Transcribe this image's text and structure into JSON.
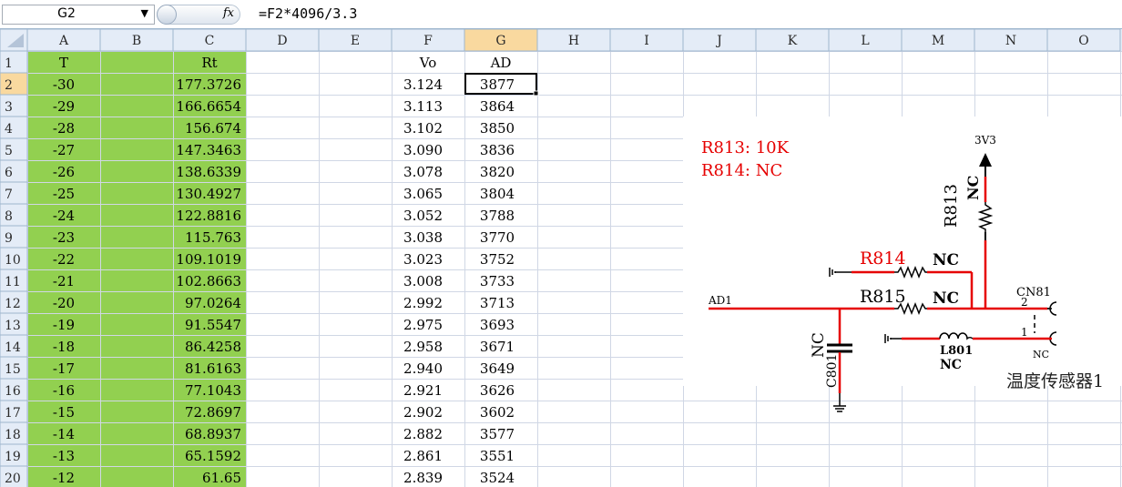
{
  "name_box": {
    "value": "G2",
    "dropdown_glyph": "▼"
  },
  "formula_bar": {
    "fx_label": "fx",
    "formula": "=F2*4096/3.3"
  },
  "sheet": {
    "columns": [
      "A",
      "B",
      "C",
      "D",
      "E",
      "F",
      "G",
      "H",
      "I",
      "J",
      "K",
      "L",
      "M",
      "N",
      "O"
    ],
    "selected_column": "G",
    "selected_row": 2,
    "header_row": {
      "A": "T",
      "C": "Rt",
      "F": "Vo",
      "G": "AD"
    },
    "rows": [
      {
        "n": 2,
        "T": "-30",
        "Rt": "177.3726",
        "Vo": "3.124",
        "AD": "3877"
      },
      {
        "n": 3,
        "T": "-29",
        "Rt": "166.6654",
        "Vo": "3.113",
        "AD": "3864"
      },
      {
        "n": 4,
        "T": "-28",
        "Rt": "156.674",
        "Vo": "3.102",
        "AD": "3850"
      },
      {
        "n": 5,
        "T": "-27",
        "Rt": "147.3463",
        "Vo": "3.090",
        "AD": "3836"
      },
      {
        "n": 6,
        "T": "-26",
        "Rt": "138.6339",
        "Vo": "3.078",
        "AD": "3820"
      },
      {
        "n": 7,
        "T": "-25",
        "Rt": "130.4927",
        "Vo": "3.065",
        "AD": "3804"
      },
      {
        "n": 8,
        "T": "-24",
        "Rt": "122.8816",
        "Vo": "3.052",
        "AD": "3788"
      },
      {
        "n": 9,
        "T": "-23",
        "Rt": "115.763",
        "Vo": "3.038",
        "AD": "3770"
      },
      {
        "n": 10,
        "T": "-22",
        "Rt": "109.1019",
        "Vo": "3.023",
        "AD": "3752"
      },
      {
        "n": 11,
        "T": "-21",
        "Rt": "102.8663",
        "Vo": "3.008",
        "AD": "3733"
      },
      {
        "n": 12,
        "T": "-20",
        "Rt": "97.0264",
        "Vo": "2.992",
        "AD": "3713"
      },
      {
        "n": 13,
        "T": "-19",
        "Rt": "91.5547",
        "Vo": "2.975",
        "AD": "3693"
      },
      {
        "n": 14,
        "T": "-18",
        "Rt": "86.4258",
        "Vo": "2.958",
        "AD": "3671"
      },
      {
        "n": 15,
        "T": "-17",
        "Rt": "81.6163",
        "Vo": "2.940",
        "AD": "3649"
      },
      {
        "n": 16,
        "T": "-16",
        "Rt": "77.1043",
        "Vo": "2.921",
        "AD": "3626"
      },
      {
        "n": 17,
        "T": "-15",
        "Rt": "72.8697",
        "Vo": "2.902",
        "AD": "3602"
      },
      {
        "n": 18,
        "T": "-14",
        "Rt": "68.8937",
        "Vo": "2.882",
        "AD": "3577"
      },
      {
        "n": 19,
        "T": "-13",
        "Rt": "65.1592",
        "Vo": "2.861",
        "AD": "3551"
      },
      {
        "n": 20,
        "T": "-12",
        "Rt": "61.65",
        "Vo": "2.839",
        "AD": "3524"
      }
    ]
  },
  "schematic": {
    "note_lines": [
      "R813: 10K",
      "R814: NC"
    ],
    "labels": {
      "r813": "R813",
      "r813_nc": "NC",
      "v3v3": "3V3",
      "r814": "R814",
      "r814_nc": "NC",
      "r815": "R815",
      "r815_nc": "NC",
      "ad1": "AD1",
      "cn81": "CN81",
      "pin2": "2",
      "pin1": "1",
      "cn_nc": "NC",
      "c801": "C801",
      "c801_nc": "NC",
      "l801": "L801",
      "l801_nc": "NC",
      "caption": "温度传感器1"
    }
  },
  "colors": {
    "green_fill": "#92d050",
    "header_bg": "#e4ecf7",
    "selected_header": "#f9d99f",
    "grid_line": "#d0d7e5",
    "wire_red": "#e60000",
    "note_red": "#e60000"
  }
}
